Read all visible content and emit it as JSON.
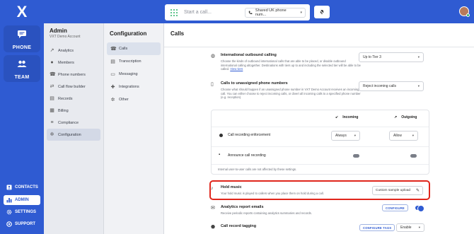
{
  "app": {
    "logo_text": "X",
    "rail": {
      "phone_label": "PHONE",
      "team_label": "TEAM",
      "contacts_label": "CONTACTS",
      "admin_label": "ADMIN",
      "settings_label": "SETTINGS",
      "support_label": "SUPPORT"
    },
    "brand_color": "#2f5bd2"
  },
  "topbar": {
    "call_placeholder": "Start a call...",
    "phone_select": "Shared UK phone num..."
  },
  "admin": {
    "title": "Admin",
    "subtitle": "VXT Demo Account",
    "items": [
      {
        "label": "Analytics",
        "icon": "analytics-icon"
      },
      {
        "label": "Members",
        "icon": "members-icon"
      },
      {
        "label": "Phone numbers",
        "icon": "phone-icon"
      },
      {
        "label": "Call flow builder",
        "icon": "flow-icon"
      },
      {
        "label": "Records",
        "icon": "records-icon"
      },
      {
        "label": "Billing",
        "icon": "billing-icon"
      },
      {
        "label": "Compliance",
        "icon": "compliance-icon"
      },
      {
        "label": "Configuration",
        "icon": "gear-icon",
        "active": true
      }
    ]
  },
  "configuration": {
    "title": "Configuration",
    "items": [
      {
        "label": "Calls",
        "icon": "phone-icon",
        "active": true
      },
      {
        "label": "Transcription",
        "icon": "document-icon"
      },
      {
        "label": "Messaging",
        "icon": "message-icon"
      },
      {
        "label": "Integrations",
        "icon": "puzzle-icon"
      },
      {
        "label": "Other",
        "icon": "gear-icon"
      }
    ]
  },
  "calls": {
    "title": "Calls",
    "international": {
      "title": "International outbound calling",
      "desc": "Choose the kinds of outbound international calls that are able to be placed, or disable outbound international calling altogether. Destinations with tiers up to and including the selected tier will be able to be called.",
      "link": "View tiers",
      "value": "Up to Tier 3"
    },
    "unassigned": {
      "title": "Calls to unassigned phone numbers",
      "desc": "Choose what should happen if an unassigned phone number in VXT Demo Account receives an incoming call. You can either choose to reject incoming calls, or divert all incoming calls to a specified phone number (e.g. reception).",
      "value": "Reject incoming calls"
    },
    "panel": {
      "incoming_header": "Incoming",
      "outgoing_header": "Outgoing",
      "recording_enforcement": {
        "title": "Call recording enforcement",
        "incoming_value": "Always",
        "outgoing_value": "Allow"
      },
      "announce": {
        "title": "Announce call recording"
      },
      "note": "Internal user-to-user calls are not affected by these settings."
    },
    "hold_music": {
      "title": "Hold music",
      "desc": "Your hold music is played to callers when you place them on hold during a call.",
      "button": "Custom sample upload"
    },
    "analytics": {
      "title": "Analytics report emails",
      "desc": "Receive periodic reports containing analytics summaries and records.",
      "button": "CONFIGURE",
      "enabled": true
    },
    "tagging": {
      "title": "Call record tagging",
      "button": "CONFIGURE TAGS",
      "value": "Enable"
    }
  }
}
